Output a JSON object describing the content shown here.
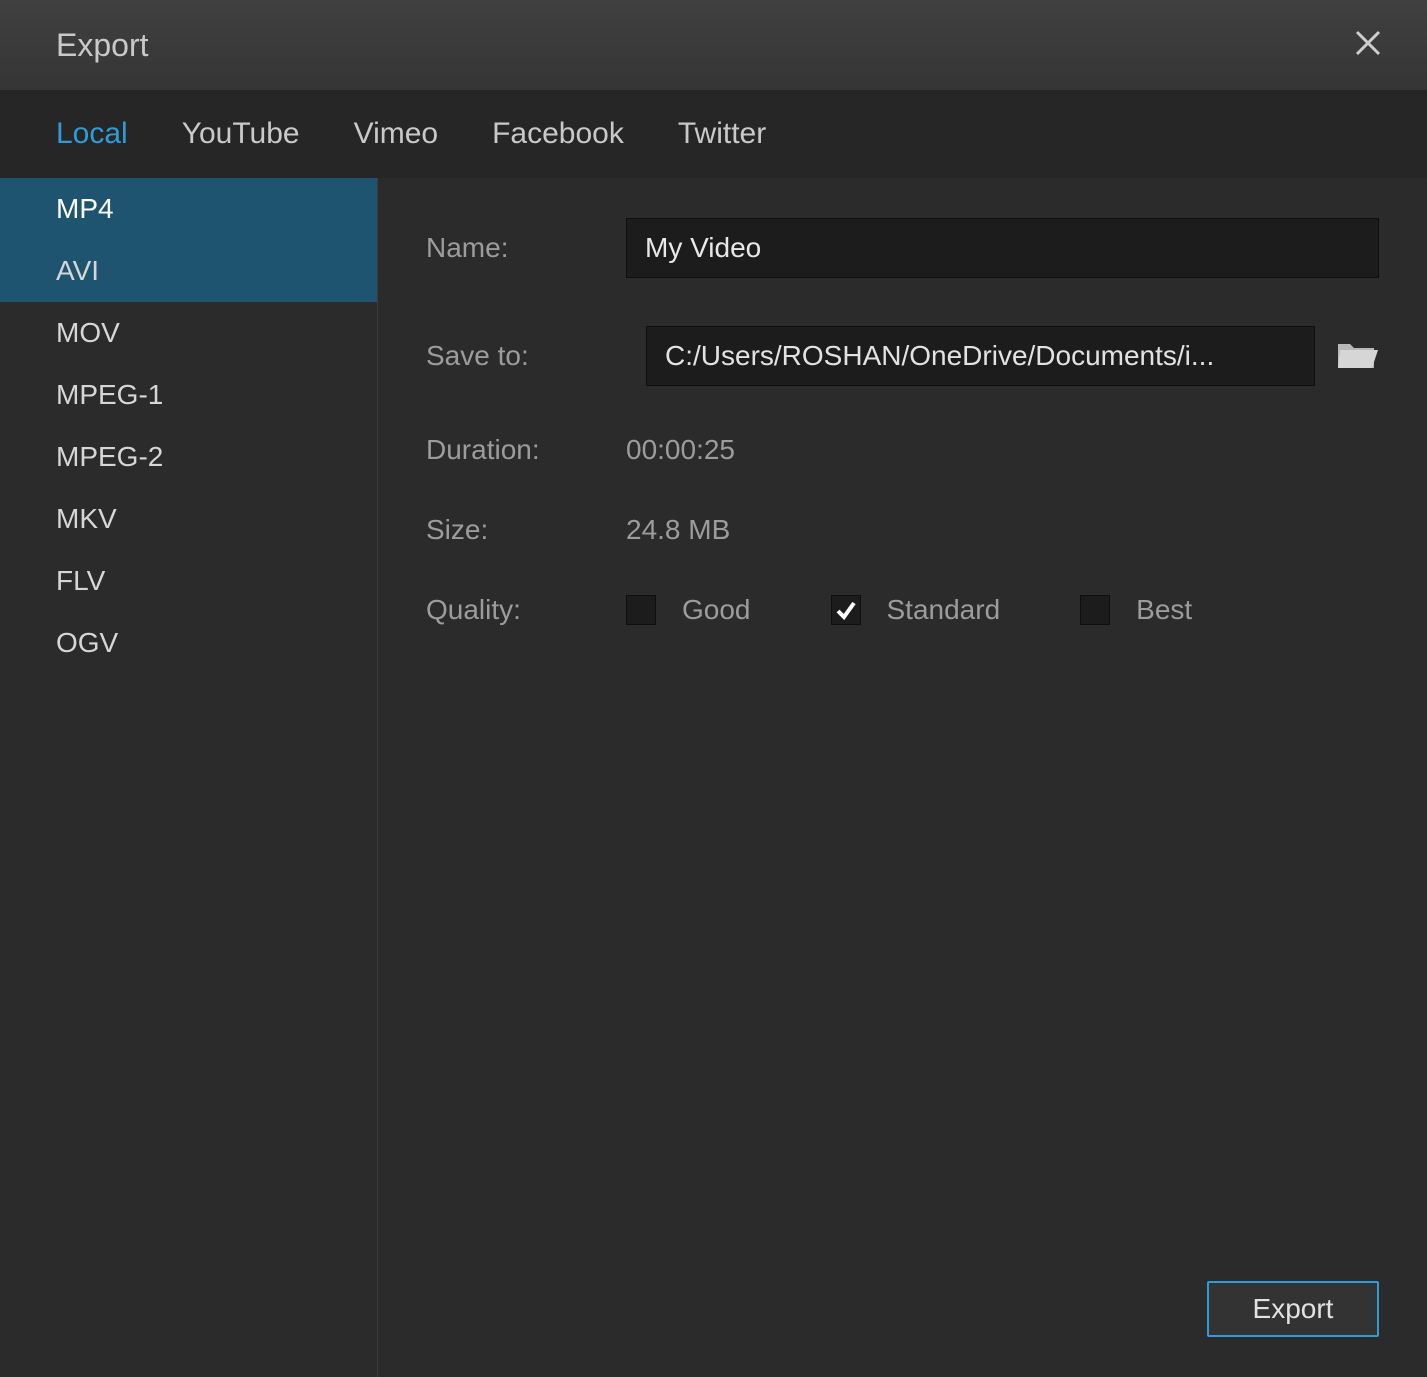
{
  "window": {
    "title": "Export"
  },
  "tabs": [
    {
      "label": "Local",
      "active": true
    },
    {
      "label": "YouTube",
      "active": false
    },
    {
      "label": "Vimeo",
      "active": false
    },
    {
      "label": "Facebook",
      "active": false
    },
    {
      "label": "Twitter",
      "active": false
    }
  ],
  "formats": [
    {
      "label": "MP4",
      "state": "selected"
    },
    {
      "label": "AVI",
      "state": "hover"
    },
    {
      "label": "MOV",
      "state": ""
    },
    {
      "label": "MPEG-1",
      "state": ""
    },
    {
      "label": "MPEG-2",
      "state": ""
    },
    {
      "label": "MKV",
      "state": ""
    },
    {
      "label": "FLV",
      "state": ""
    },
    {
      "label": "OGV",
      "state": ""
    }
  ],
  "form": {
    "name_label": "Name:",
    "name_value": "My Video",
    "save_label": "Save to:",
    "save_value": "C:/Users/ROSHAN/OneDrive/Documents/i...",
    "duration_label": "Duration:",
    "duration_value": "00:00:25",
    "size_label": "Size:",
    "size_value": "24.8 MB",
    "quality_label": "Quality:",
    "quality_options": [
      {
        "label": "Good",
        "checked": false
      },
      {
        "label": "Standard",
        "checked": true
      },
      {
        "label": "Best",
        "checked": false
      }
    ]
  },
  "footer": {
    "export_label": "Export"
  },
  "colors": {
    "accent": "#2e9cd6",
    "sidebar_selected": "#1e5470",
    "bg_dark": "#2b2b2b",
    "input_bg": "#1c1c1c"
  }
}
